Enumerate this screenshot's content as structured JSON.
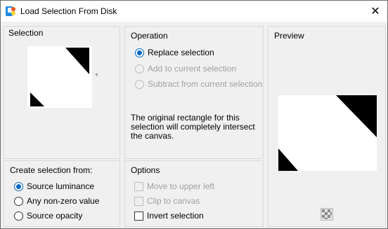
{
  "window": {
    "title": "Load Selection From Disk",
    "close_glyph": "✕"
  },
  "selection_panel": {
    "title": "Selection",
    "thumbnail_icon": "selection-mask-thumbnail"
  },
  "operation_panel": {
    "title": "Operation",
    "options": [
      {
        "label": "Replace selection",
        "checked": true,
        "enabled": true
      },
      {
        "label": "Add to current selection",
        "checked": false,
        "enabled": false
      },
      {
        "label": "Subtract from current selection",
        "checked": false,
        "enabled": false
      }
    ],
    "info": "The original rectangle for this selection will completely intersect the canvas."
  },
  "preview_panel": {
    "title": "Preview",
    "transparency_icon": "checkerboard-icon"
  },
  "create_panel": {
    "title": "Create selection from:",
    "options": [
      {
        "label": "Source luminance",
        "checked": true
      },
      {
        "label": "Any non-zero value",
        "checked": false
      },
      {
        "label": "Source opacity",
        "checked": false
      }
    ]
  },
  "options_panel": {
    "title": "Options",
    "items": [
      {
        "label": "Move to upper left",
        "checked": false,
        "enabled": false
      },
      {
        "label": "Clip to canvas",
        "checked": false,
        "enabled": false
      },
      {
        "label": "Invert selection",
        "checked": false,
        "enabled": true
      }
    ]
  },
  "colors": {
    "accent": "#0067c0",
    "disabled_text": "#a0a0a0"
  }
}
